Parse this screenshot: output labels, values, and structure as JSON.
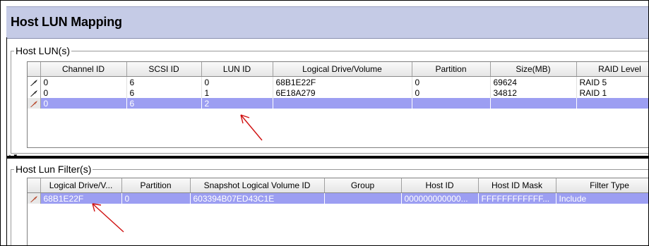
{
  "window": {
    "title": "Host LUN Mapping"
  },
  "host_luns": {
    "legend": "Host LUN(s)",
    "columns": [
      "Channel ID",
      "SCSI ID",
      "LUN ID",
      "Logical Drive/Volume",
      "Partition",
      "Size(MB)",
      "RAID Level"
    ],
    "rows": [
      {
        "cells": [
          "0",
          "6",
          "0",
          "68B1E22F",
          "0",
          "69624",
          "RAID 5"
        ],
        "selected": false
      },
      {
        "cells": [
          "0",
          "6",
          "1",
          "6E18A279",
          "0",
          "34812",
          "RAID 1"
        ],
        "selected": false
      },
      {
        "cells": [
          "0",
          "6",
          "2",
          "",
          "",
          "",
          ""
        ],
        "selected": true
      }
    ]
  },
  "host_lun_filters": {
    "legend": "Host Lun Filter(s)",
    "columns": [
      "Logical Drive/V...",
      "Partition",
      "Snapshot Logical Volume ID",
      "Group",
      "Host ID",
      "Host ID Mask",
      "Filter Type"
    ],
    "rows": [
      {
        "cells": [
          "68B1E22F",
          "0",
          "603394B07ED43C1E",
          "",
          "000000000000...",
          "FFFFFFFFFFFF...",
          "Include"
        ],
        "selected": true
      }
    ]
  },
  "icons": {
    "row_indicator": "row-pointer-icon",
    "annotation": "red-arrow-annotation"
  },
  "colors": {
    "title_bar": "#c5cbe6",
    "selection": "#9c9ef2",
    "annotation": "#d01010"
  }
}
